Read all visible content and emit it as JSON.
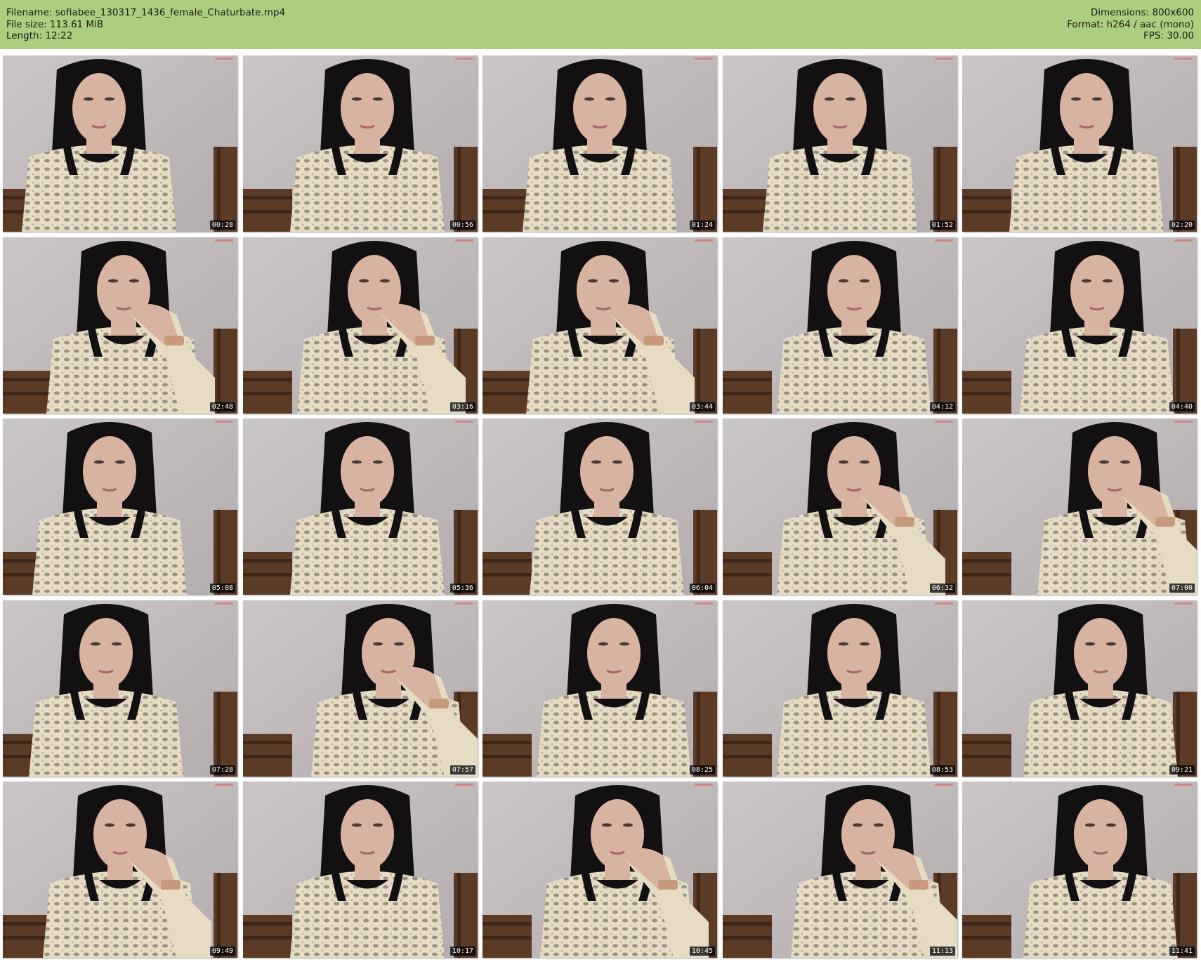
{
  "header": {
    "filename": "Filename: sofiabee_130317_1436_female_Chaturbate.mp4",
    "filesize": "File size: 113.61 MiB",
    "length": "Length: 12:22",
    "dimensions": "Dimensions: 800x600",
    "format": "Format: h264 / aac (mono)",
    "fps": "FPS: 30.00"
  },
  "colors": {
    "header_bg": "#afcd7f",
    "wall": "#c2bcbd",
    "hair": "#121010",
    "skin": "#d9b3a1",
    "sweater": "#e6dcc4",
    "lace_shadow": "#5a5752",
    "bench": "#5b3a26"
  },
  "thumbnails": [
    {
      "time": "00:28"
    },
    {
      "time": "00:56"
    },
    {
      "time": "01:24"
    },
    {
      "time": "01:52"
    },
    {
      "time": "02:20"
    },
    {
      "time": "02:48"
    },
    {
      "time": "03:16"
    },
    {
      "time": "03:44"
    },
    {
      "time": "04:12"
    },
    {
      "time": "04:40"
    },
    {
      "time": "05:08"
    },
    {
      "time": "05:36"
    },
    {
      "time": "06:04"
    },
    {
      "time": "06:32"
    },
    {
      "time": "07:00"
    },
    {
      "time": "07:28"
    },
    {
      "time": "07:57"
    },
    {
      "time": "08:25"
    },
    {
      "time": "08:53"
    },
    {
      "time": "09:21"
    },
    {
      "time": "09:49"
    },
    {
      "time": "10:17"
    },
    {
      "time": "10:45"
    },
    {
      "time": "11:13"
    },
    {
      "time": "11:41"
    }
  ]
}
